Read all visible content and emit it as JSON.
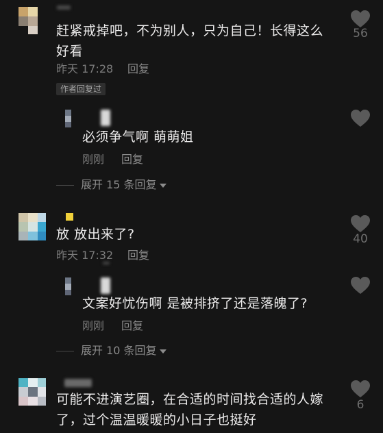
{
  "comments": [
    {
      "text_line1": "赶紧戒掉吧，不为别人，只为自己！长得这么",
      "text_line2": "好看",
      "time": "昨天 17:28",
      "reply": "回复",
      "likes": "56",
      "tag": "作者回复过",
      "replies": [
        {
          "text": "必须争气啊 萌萌姐",
          "time": "刚刚",
          "reply": "回复"
        }
      ],
      "expand": "展开 15 条回复"
    },
    {
      "text_line1": "放 放出来了?",
      "time": "昨天 17:32",
      "reply": "回复",
      "likes": "40",
      "replies": [
        {
          "text": "文案好忧伤啊 是被排挤了还是落魄了?",
          "time": "刚刚",
          "reply": "回复"
        }
      ],
      "expand": "展开 10 条回复"
    },
    {
      "text_line1": "可能不进演艺圈，在合适的时间找合适的人嫁",
      "text_line2": "了，过个温温暖暖的小日子也挺好",
      "likes": "6"
    }
  ],
  "colors": {
    "background": "#151515",
    "text": "#ecebeb",
    "meta": "#7c7c7c",
    "heart": "#5a5a5a"
  },
  "icons": {
    "like": "heart-icon",
    "expand": "chevron-down-icon"
  }
}
